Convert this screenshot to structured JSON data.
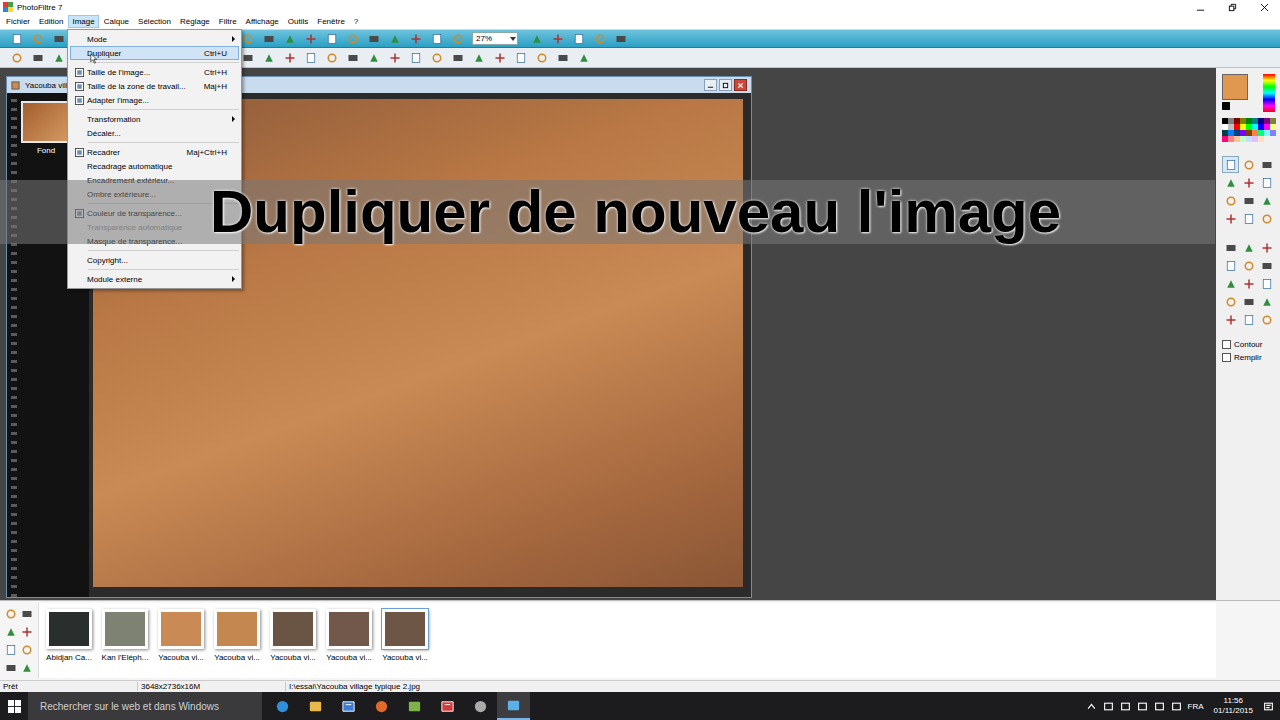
{
  "window": {
    "title": "PhotoFiltre 7"
  },
  "menubar": [
    {
      "label": "Fichier",
      "selected": false
    },
    {
      "label": "Edition",
      "selected": false
    },
    {
      "label": "Image",
      "selected": true
    },
    {
      "label": "Calque",
      "selected": false
    },
    {
      "label": "Sélection",
      "selected": false
    },
    {
      "label": "Réglage",
      "selected": false
    },
    {
      "label": "Filtre",
      "selected": false
    },
    {
      "label": "Affichage",
      "selected": false
    },
    {
      "label": "Outils",
      "selected": false
    },
    {
      "label": "Fenêtre",
      "selected": false
    },
    {
      "label": "?",
      "selected": false
    }
  ],
  "toolbar": {
    "zoom": "27%"
  },
  "document": {
    "title": "Yacouba villa",
    "layers": [
      {
        "label": "Fond",
        "selected": true
      }
    ]
  },
  "image_menu": [
    {
      "kind": "item",
      "label": "Mode",
      "shortcut": "",
      "submenu": true,
      "icon": false,
      "selected": false,
      "disabled": false
    },
    {
      "kind": "item",
      "label": "Dupliquer",
      "shortcut": "Ctrl+U",
      "submenu": false,
      "icon": false,
      "selected": true,
      "disabled": false
    },
    {
      "kind": "separator"
    },
    {
      "kind": "item",
      "label": "Taille de l'image...",
      "shortcut": "Ctrl+H",
      "submenu": false,
      "icon": true,
      "selected": false,
      "disabled": false
    },
    {
      "kind": "item",
      "label": "Taille de la zone de travail...",
      "shortcut": "Maj+H",
      "submenu": false,
      "icon": true,
      "selected": false,
      "disabled": false
    },
    {
      "kind": "item",
      "label": "Adapter l'image...",
      "shortcut": "",
      "submenu": false,
      "icon": true,
      "selected": false,
      "disabled": false
    },
    {
      "kind": "separator"
    },
    {
      "kind": "item",
      "label": "Transformation",
      "shortcut": "",
      "submenu": true,
      "icon": false,
      "selected": false,
      "disabled": false
    },
    {
      "kind": "item",
      "label": "Décaler...",
      "shortcut": "",
      "submenu": false,
      "icon": false,
      "selected": false,
      "disabled": false
    },
    {
      "kind": "separator"
    },
    {
      "kind": "item",
      "label": "Recadrer",
      "shortcut": "Maj+Ctrl+H",
      "submenu": false,
      "icon": true,
      "selected": false,
      "disabled": false
    },
    {
      "kind": "item",
      "label": "Recadrage automatique",
      "shortcut": "",
      "submenu": false,
      "icon": false,
      "selected": false,
      "disabled": false
    },
    {
      "kind": "item",
      "label": "Encadrement extérieur...",
      "shortcut": "",
      "submenu": false,
      "icon": false,
      "selected": false,
      "disabled": false
    },
    {
      "kind": "item",
      "label": "Ombre extérieure...",
      "shortcut": "",
      "submenu": false,
      "icon": false,
      "selected": false,
      "disabled": false
    },
    {
      "kind": "separator"
    },
    {
      "kind": "item",
      "label": "Couleur de transparence...",
      "shortcut": "",
      "submenu": false,
      "icon": true,
      "selected": false,
      "disabled": false
    },
    {
      "kind": "item",
      "label": "Transparence automatique",
      "shortcut": "",
      "submenu": false,
      "icon": false,
      "selected": false,
      "disabled": true
    },
    {
      "kind": "item",
      "label": "Masque de transparence...",
      "shortcut": "",
      "submenu": false,
      "icon": false,
      "selected": false,
      "disabled": false
    },
    {
      "kind": "separator"
    },
    {
      "kind": "item",
      "label": "Copyright...",
      "shortcut": "",
      "submenu": false,
      "icon": false,
      "selected": false,
      "disabled": false
    },
    {
      "kind": "separator"
    },
    {
      "kind": "item",
      "label": "Module externe",
      "shortcut": "",
      "submenu": true,
      "icon": false,
      "selected": false,
      "disabled": false
    }
  ],
  "overlay": {
    "caption": "Dupliquer de nouveau l'image"
  },
  "colors": {
    "foreground": "#e0974f",
    "background": "#000000",
    "swatches": [
      "#000000",
      "#808080",
      "#800000",
      "#808000",
      "#008000",
      "#008080",
      "#000080",
      "#800080",
      "#808040",
      "#ffffff",
      "#c0c0c0",
      "#ff0000",
      "#ffff00",
      "#00ff00",
      "#00ffff",
      "#0000ff",
      "#ff00ff",
      "#ffff80",
      "#004040",
      "#0080ff",
      "#004080",
      "#8000ff",
      "#804000",
      "#ff8040",
      "#00ff80",
      "#80ffff",
      "#8080ff",
      "#ff0080",
      "#ff8080",
      "#ffc0a0",
      "#c0ffc0",
      "#c0e0ff",
      "#e0c0ff",
      "#ffe0c0",
      "#f0f0f0"
    ]
  },
  "tool_options": [
    {
      "label": "Contour",
      "checked": false
    },
    {
      "label": "Remplir",
      "checked": false
    }
  ],
  "thumbnails": [
    {
      "label": "Abidjan Ca...",
      "selected": false,
      "color": "#2a2e2c"
    },
    {
      "label": "Kan l'Eléph...",
      "selected": false,
      "color": "#7d8273"
    },
    {
      "label": "Yacouba vi...",
      "selected": false,
      "color": "#c98a55"
    },
    {
      "label": "Yacouba vi...",
      "selected": false,
      "color": "#c4874f"
    },
    {
      "label": "Yacouba vi...",
      "selected": false,
      "color": "#6a5443"
    },
    {
      "label": "Yacouba vi...",
      "selected": false,
      "color": "#72584a"
    },
    {
      "label": "Yacouba vi...",
      "selected": true,
      "color": "#6e5646"
    }
  ],
  "status_bar": {
    "state": "Prêt",
    "size": "3648x2736x16M",
    "path": "I:\\essai\\Yacouba village typique 2.jpg"
  },
  "taskbar": {
    "search": "Rechercher sur le web et dans Windows",
    "language": "FRA",
    "time": "11:56",
    "date": "01/11/2015"
  }
}
